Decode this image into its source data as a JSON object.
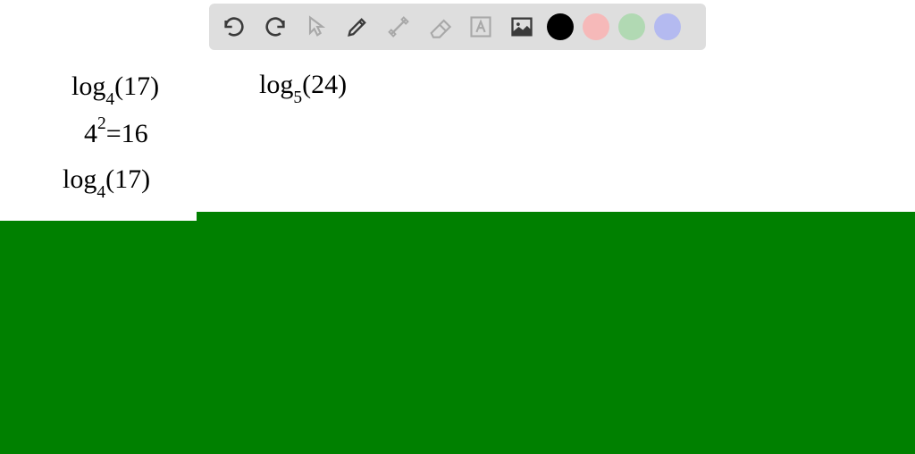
{
  "toolbar": {
    "undo_label": "Undo",
    "redo_label": "Redo",
    "pointer_label": "Pointer",
    "pencil_label": "Pencil",
    "tools_label": "Tools",
    "eraser_label": "Eraser",
    "text_label": "Text",
    "image_label": "Image",
    "colors": {
      "black": "#000000",
      "pink": "#f6b9b9",
      "green": "#b1d9b3",
      "blue": "#b4baf0"
    }
  },
  "handwriting": {
    "line1": "log₄(17)",
    "line1_base": "log",
    "line1_sub": "4",
    "line1_arg": "(17)",
    "line2": "log₅(24)",
    "line2_base": "log",
    "line2_sub": "5",
    "line2_arg": "(24)",
    "line3": "4²=16",
    "line3_base": "4",
    "line3_sup": "2",
    "line3_rest": "=16",
    "line4": "log₄(17)",
    "line4_base": "log",
    "line4_sub": "4",
    "line4_arg": "(17)"
  },
  "canvas": {
    "green_fill": "#008000"
  }
}
